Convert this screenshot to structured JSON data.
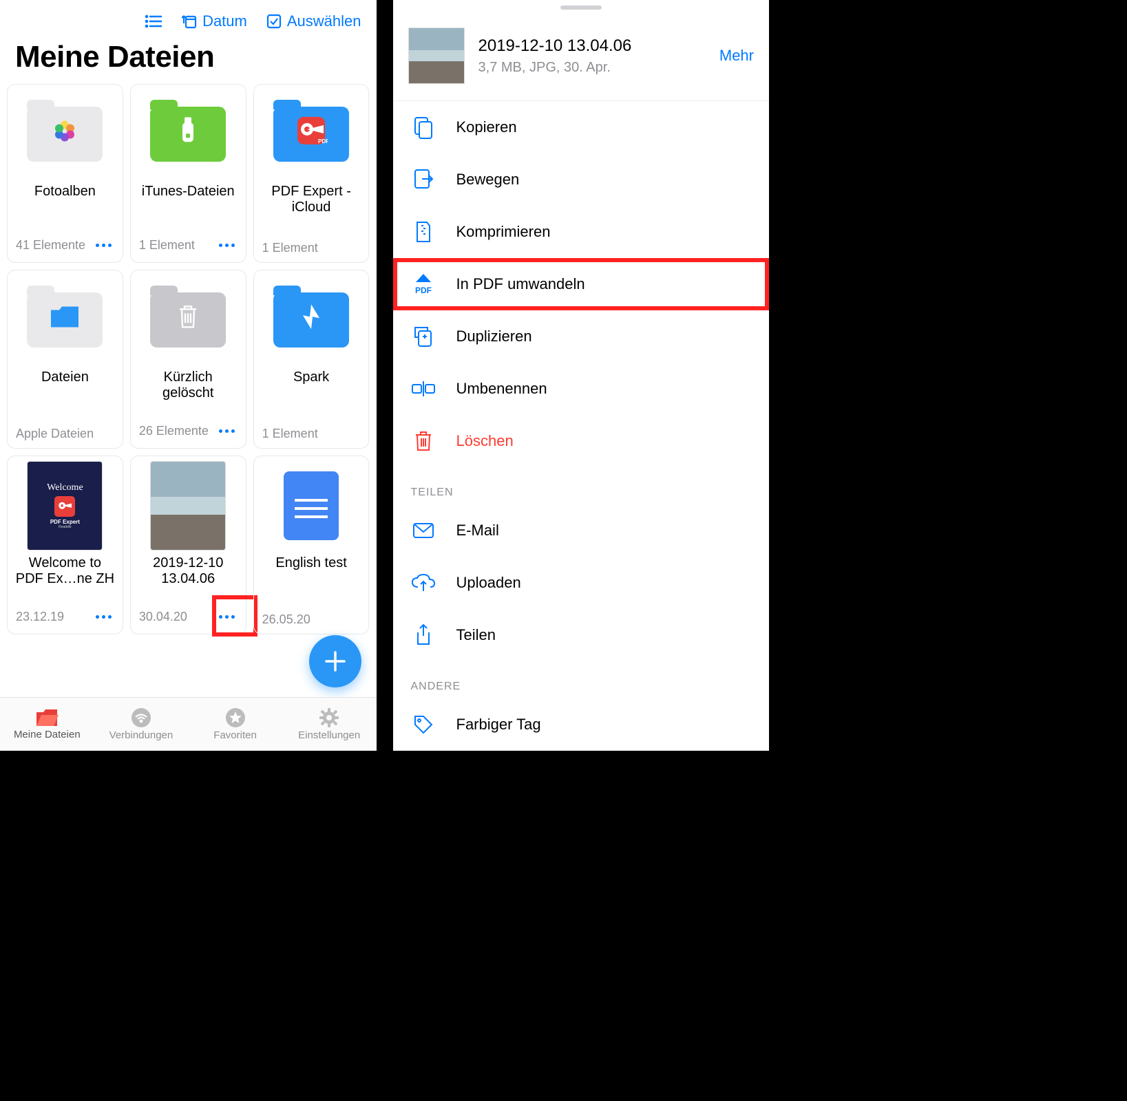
{
  "left": {
    "toolbar": {
      "sort_label": "Datum",
      "select_label": "Auswählen"
    },
    "title": "Meine Dateien",
    "items": [
      {
        "name": "Fotoalben",
        "meta": "41 Elemente",
        "has_more": true
      },
      {
        "name": "iTunes-Dateien",
        "meta": "1 Element",
        "has_more": true
      },
      {
        "name": "PDF Expert -\niCloud",
        "meta": "1 Element",
        "has_more": false
      },
      {
        "name": "Dateien",
        "meta": "Apple Dateien",
        "has_more": false
      },
      {
        "name": "Kürzlich\ngelöscht",
        "meta": "26 Elemente",
        "has_more": true
      },
      {
        "name": "Spark",
        "meta": "1 Element",
        "has_more": false
      },
      {
        "name": "Welcome to\nPDF Ex…ne ZH",
        "meta": "23.12.19",
        "has_more": true
      },
      {
        "name": "2019-12-10\n13.04.06",
        "meta": "30.04.20",
        "has_more": true
      },
      {
        "name": "English test",
        "meta": "26.05.20",
        "has_more": false
      }
    ],
    "tabs": [
      {
        "label": "Meine Dateien",
        "active": true
      },
      {
        "label": "Verbindungen",
        "active": false
      },
      {
        "label": "Favoriten",
        "active": false
      },
      {
        "label": "Einstellungen",
        "active": false
      }
    ]
  },
  "right": {
    "file_name": "2019-12-10 13.04.06",
    "file_meta": "3,7 MB, JPG, 30. Apr.",
    "more_label": "Mehr",
    "actions": [
      {
        "label": "Kopieren",
        "icon": "copy"
      },
      {
        "label": "Bewegen",
        "icon": "move"
      },
      {
        "label": "Komprimieren",
        "icon": "compress"
      },
      {
        "label": "In PDF umwandeln",
        "icon": "pdf",
        "highlight": true
      },
      {
        "label": "Duplizieren",
        "icon": "duplicate"
      },
      {
        "label": "Umbenennen",
        "icon": "rename"
      },
      {
        "label": "Löschen",
        "icon": "delete"
      }
    ],
    "section_share": "TEILEN",
    "share_actions": [
      {
        "label": "E-Mail",
        "icon": "mail"
      },
      {
        "label": "Uploaden",
        "icon": "upload"
      },
      {
        "label": "Teilen",
        "icon": "share"
      }
    ],
    "section_other": "ANDERE",
    "other_actions": [
      {
        "label": "Farbiger Tag",
        "icon": "tag"
      }
    ]
  }
}
